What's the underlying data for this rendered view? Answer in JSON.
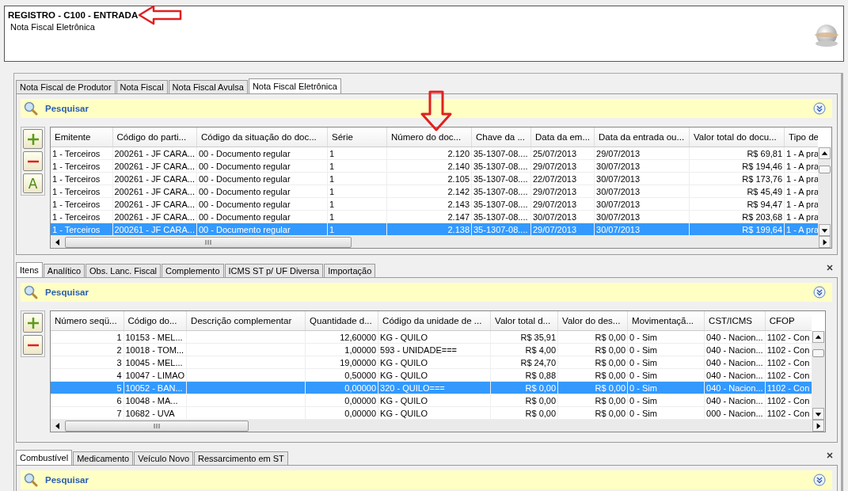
{
  "header": {
    "title": "REGISTRO - C100 - ENTRADA",
    "subtitle": "Nota Fiscal Eletrônica"
  },
  "doc_tabs": [
    {
      "label": "Nota Fiscal de Produtor",
      "selected": false
    },
    {
      "label": "Nota Fiscal",
      "selected": false
    },
    {
      "label": "Nota Fiscal Avulsa",
      "selected": false
    },
    {
      "label": "Nota Fiscal Eletrônica",
      "selected": true
    }
  ],
  "doc_search": {
    "label": "Pesquisar"
  },
  "doc_actions": [
    {
      "kind": "add"
    },
    {
      "kind": "remove"
    },
    {
      "kind": "text",
      "label": "A"
    }
  ],
  "documents": {
    "columns": [
      {
        "label": "Emitente",
        "kind": "text"
      },
      {
        "label": "Código do parti...",
        "kind": "text"
      },
      {
        "label": "Código da situação do doc...",
        "kind": "text"
      },
      {
        "label": "Série",
        "kind": "text"
      },
      {
        "label": "Número do doc...",
        "kind": "number"
      },
      {
        "label": "Chave da ...",
        "kind": "text"
      },
      {
        "label": "Data da em...",
        "kind": "text"
      },
      {
        "label": "Data da entrada ou...",
        "kind": "text"
      },
      {
        "label": "Valor total do docu...",
        "kind": "number"
      },
      {
        "label": "Tipo de",
        "kind": "text"
      }
    ],
    "rows": [
      {
        "cells": [
          "1 - Terceiros",
          "200261 - JF CARA...",
          "00 - Documento regular",
          "1",
          "2.120",
          "35-1307-08....",
          "25/07/2013",
          "29/07/2013",
          "R$ 69,81",
          "1 - A pra"
        ],
        "selected": false
      },
      {
        "cells": [
          "1 - Terceiros",
          "200261 - JF CARA...",
          "00 - Documento regular",
          "1",
          "2.140",
          "35-1307-08....",
          "29/07/2013",
          "30/07/2013",
          "R$ 194,46",
          "1 - A pra"
        ],
        "selected": false
      },
      {
        "cells": [
          "1 - Terceiros",
          "200261 - JF CARA...",
          "00 - Documento regular",
          "1",
          "2.105",
          "35-1307-08....",
          "22/07/2013",
          "30/07/2013",
          "R$ 173,76",
          "1 - A pra"
        ],
        "selected": false
      },
      {
        "cells": [
          "1 - Terceiros",
          "200261 - JF CARA...",
          "00 - Documento regular",
          "1",
          "2.142",
          "35-1307-08....",
          "29/07/2013",
          "30/07/2013",
          "R$ 45,49",
          "1 - A pra"
        ],
        "selected": false
      },
      {
        "cells": [
          "1 - Terceiros",
          "200261 - JF CARA...",
          "00 - Documento regular",
          "1",
          "2.143",
          "35-1307-08....",
          "29/07/2013",
          "30/07/2013",
          "R$ 94,47",
          "1 - A pra"
        ],
        "selected": false
      },
      {
        "cells": [
          "1 - Terceiros",
          "200261 - JF CARA...",
          "00 - Documento regular",
          "1",
          "2.147",
          "35-1307-08....",
          "30/07/2013",
          "30/07/2013",
          "R$ 203,68",
          "1 - A pra"
        ],
        "selected": false
      },
      {
        "cells": [
          "1 - Terceiros",
          "200261 - JF CARA...",
          "00 - Documento regular",
          "1",
          "2.138",
          "35-1307-08....",
          "29/07/2013",
          "30/07/2013",
          "R$ 199,64",
          "1 - A pra"
        ],
        "selected": true
      }
    ]
  },
  "item_tabs": [
    {
      "label": "Itens",
      "selected": true
    },
    {
      "label": "Analítico",
      "selected": false
    },
    {
      "label": "Obs. Lanc. Fiscal",
      "selected": false
    },
    {
      "label": "Complemento",
      "selected": false
    },
    {
      "label": "ICMS ST p/ UF Diversa",
      "selected": false
    },
    {
      "label": "Importação",
      "selected": false
    }
  ],
  "item_search": {
    "label": "Pesquisar"
  },
  "item_actions": [
    {
      "kind": "add"
    },
    {
      "kind": "remove"
    }
  ],
  "items": {
    "columns": [
      {
        "label": "Número seqü...",
        "kind": "number"
      },
      {
        "label": "Código do...",
        "kind": "text"
      },
      {
        "label": "Descrição complementar",
        "kind": "text"
      },
      {
        "label": "Quantidade d...",
        "kind": "number"
      },
      {
        "label": "Código da unidade de ...",
        "kind": "text"
      },
      {
        "label": "Valor total d...",
        "kind": "number"
      },
      {
        "label": "Valor do des...",
        "kind": "number"
      },
      {
        "label": "Movimentaçã...",
        "kind": "text"
      },
      {
        "label": "CST/ICMS",
        "kind": "text"
      },
      {
        "label": "CFOP",
        "kind": "text"
      }
    ],
    "rows": [
      {
        "cells": [
          "1",
          "10153 - MEL...",
          "",
          "12,60000",
          "KG - QUILO",
          "R$ 35,91",
          "R$ 0,00",
          "0 - Sim",
          "040 - Nacion...",
          "1102 - Con"
        ],
        "selected": false
      },
      {
        "cells": [
          "2",
          "10018 - TOM...",
          "",
          "1,00000",
          "593 - UNIDADE===",
          "R$ 4,00",
          "R$ 0,00",
          "0 - Sim",
          "040 - Nacion...",
          "1102 - Con"
        ],
        "selected": false
      },
      {
        "cells": [
          "3",
          "10045 - MEL...",
          "",
          "19,00000",
          "KG - QUILO",
          "R$ 24,70",
          "R$ 0,00",
          "0 - Sim",
          "040 - Nacion...",
          "1102 - Con"
        ],
        "selected": false
      },
      {
        "cells": [
          "4",
          "10047 - LIMAO",
          "",
          "0,50000",
          "KG - QUILO",
          "R$ 0,88",
          "R$ 0,00",
          "0 - Sim",
          "040 - Nacion...",
          "1102 - Con"
        ],
        "selected": false
      },
      {
        "cells": [
          "5",
          "10052 - BAN...",
          "",
          "0,00000",
          "320 - QUILO===",
          "R$ 0,00",
          "R$ 0,00",
          "0 - Sim",
          "040 - Nacion...",
          "1102 - Con"
        ],
        "selected": true
      },
      {
        "cells": [
          "6",
          "10048 - MA...",
          "",
          "0,00000",
          "KG - QUILO",
          "R$ 0,00",
          "R$ 0,00",
          "0 - Sim",
          "040 - Nacion...",
          "1102 - Con"
        ],
        "selected": false
      },
      {
        "cells": [
          "7",
          "10682 - UVA",
          "",
          "0,00000",
          "KG - QUILO",
          "R$ 0,00",
          "R$ 0,00",
          "0 - Sim",
          "000 - Nacion...",
          "1102 - Con"
        ],
        "selected": false
      }
    ]
  },
  "detail_tabs": [
    {
      "label": "Combustível",
      "selected": true
    },
    {
      "label": "Medicamento",
      "selected": false
    },
    {
      "label": "Veículo Novo",
      "selected": false
    },
    {
      "label": "Ressarcimento em ST",
      "selected": false
    }
  ],
  "detail_search": {
    "label": "Pesquisar"
  }
}
